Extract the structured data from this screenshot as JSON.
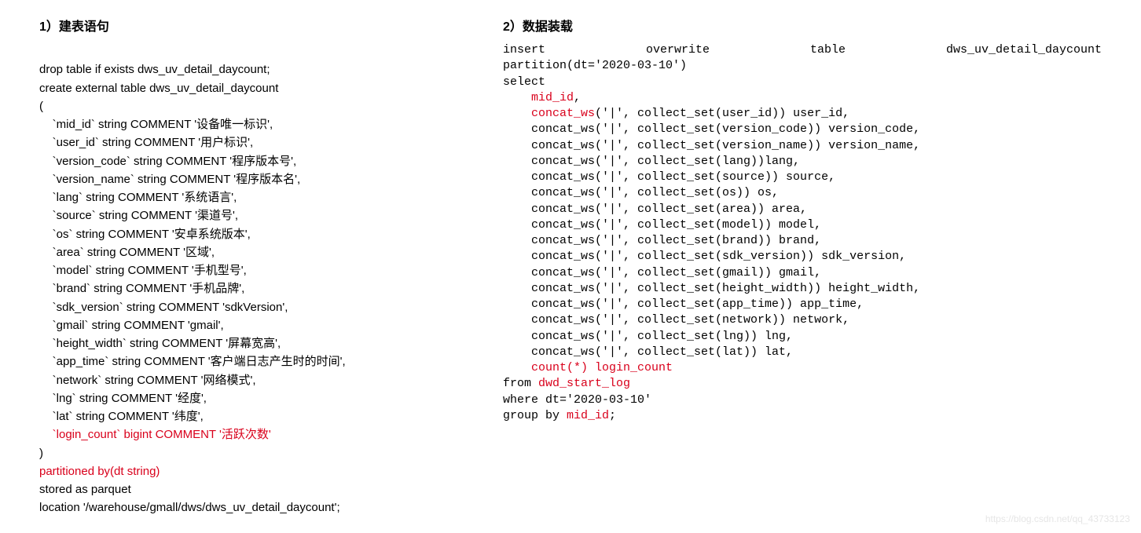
{
  "left": {
    "title": "1）建表语句",
    "l1": "drop table if exists dws_uv_detail_daycount;",
    "l2": "create external table dws_uv_detail_daycount",
    "l3": "(",
    "cols": [
      "    `mid_id` string COMMENT '设备唯一标识',",
      "    `user_id` string COMMENT '用户标识',",
      "    `version_code` string COMMENT '程序版本号',",
      "    `version_name` string COMMENT '程序版本名',",
      "    `lang` string COMMENT '系统语言',",
      "    `source` string COMMENT '渠道号',",
      "    `os` string COMMENT '安卓系统版本',",
      "    `area` string COMMENT '区域',",
      "    `model` string COMMENT '手机型号',",
      "    `brand` string COMMENT '手机品牌',",
      "    `sdk_version` string COMMENT 'sdkVersion',",
      "    `gmail` string COMMENT 'gmail',",
      "    `height_width` string COMMENT '屏幕宽高',",
      "    `app_time` string COMMENT '客户端日志产生时的时间',",
      "    `network` string COMMENT '网络模式',",
      "    `lng` string COMMENT '经度',",
      "    `lat` string COMMENT '纬度',"
    ],
    "login_count": "    `login_count` bigint COMMENT '活跃次数'",
    "close_paren": ")",
    "partitioned": "partitioned by(dt string)",
    "stored": "stored as parquet",
    "location": "location '/warehouse/gmall/dws/dws_uv_detail_daycount';"
  },
  "right": {
    "title": "2）数据装载",
    "ins_words": [
      "insert",
      "overwrite",
      "table",
      "dws_uv_detail_daycount"
    ],
    "partition": "partition(dt='2020-03-10')",
    "select": "select",
    "midid": "    mid_id",
    "midid_comma": ",",
    "cw_pre": "    concat_ws",
    "cw_post": "('|', collect_set(user_id)) user_id,",
    "rest": [
      "    concat_ws('|', collect_set(version_code)) version_code,",
      "    concat_ws('|', collect_set(version_name)) version_name,",
      "    concat_ws('|', collect_set(lang))lang,",
      "    concat_ws('|', collect_set(source)) source,",
      "    concat_ws('|', collect_set(os)) os,",
      "    concat_ws('|', collect_set(area)) area,",
      "    concat_ws('|', collect_set(model)) model,",
      "    concat_ws('|', collect_set(brand)) brand,",
      "    concat_ws('|', collect_set(sdk_version)) sdk_version,",
      "    concat_ws('|', collect_set(gmail)) gmail,",
      "    concat_ws('|', collect_set(height_width)) height_width,",
      "    concat_ws('|', collect_set(app_time)) app_time,",
      "    concat_ws('|', collect_set(network)) network,",
      "    concat_ws('|', collect_set(lng)) lng,",
      "    concat_ws('|', collect_set(lat)) lat,"
    ],
    "count": "    count(*) login_count",
    "from_pre": "from ",
    "from_tbl": "dwd_start_log",
    "where": "where dt='2020-03-10'",
    "group_pre": "group by ",
    "group_col": "mid_id",
    "group_end": ";"
  },
  "watermark": "https://blog.csdn.net/qq_43733123"
}
